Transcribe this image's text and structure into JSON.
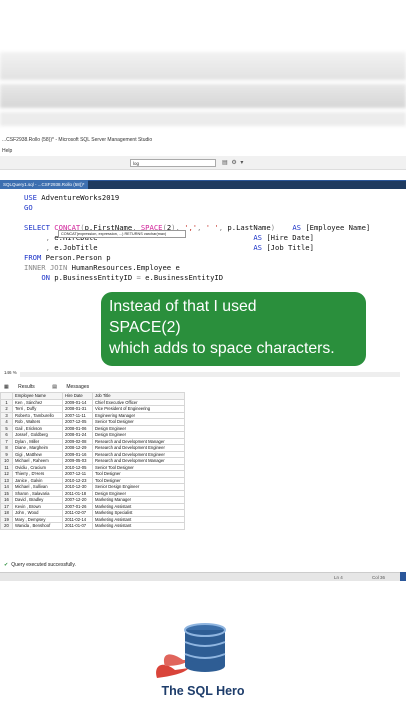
{
  "window": {
    "title": "...CSF2938.Rollo (58))* - Microsoft SQL Server Management Studio",
    "menu_fragment": "Help"
  },
  "toolbar": {
    "search_value": "log",
    "icons": [
      "database-icon",
      "settings-icon",
      "dropdown-icon"
    ]
  },
  "tab": {
    "label": "SQLQuery1.sql - ...CSF2938.Rollo (58))*"
  },
  "editor": {
    "lines": [
      "USE AdventureWorks2019",
      "GO",
      "",
      "SELECT CONCAT(p.FirstName, SPACE(2), ',', ' ', p.LastName)   AS [Employee Name]",
      "     , e.HireDate                                             AS [Hire Date]",
      "     , e.JobTitle                                             AS [Job Title]",
      "FROM Person.Person p",
      "INNER JOIN HumanResources.Employee e",
      "    ON p.BusinessEntityID = e.BusinessEntityID"
    ],
    "tooltip": "CONCAT(expression, expression, ...) RETURNS varchar(max)"
  },
  "callout": {
    "lines": [
      "Instead of that I used",
      "SPACE(2)",
      "which adds to space characters."
    ]
  },
  "zoom": "146 %",
  "results_tabs": {
    "results": "Results",
    "messages": "Messages"
  },
  "results": {
    "columns": [
      "Employee Name",
      "Hire Date",
      "Job Title"
    ],
    "rows": [
      [
        "1",
        "Ken  , Sánchez",
        "2009-01-14",
        "Chief Executive Officer"
      ],
      [
        "2",
        "Terri  , Duffy",
        "2008-01-31",
        "Vice President of Engineering"
      ],
      [
        "3",
        "Roberto  , Tamburello",
        "2007-11-11",
        "Engineering Manager"
      ],
      [
        "4",
        "Rob  , Walters",
        "2007-12-05",
        "Senior Tool Designer"
      ],
      [
        "5",
        "Gail  , Erickson",
        "2008-01-06",
        "Design Engineer"
      ],
      [
        "6",
        "Jossef  , Goldberg",
        "2008-01-24",
        "Design Engineer"
      ],
      [
        "7",
        "Dylan  , Miller",
        "2009-02-08",
        "Research and Development Manager"
      ],
      [
        "8",
        "Diane  , Margheim",
        "2008-12-29",
        "Research and Development Engineer"
      ],
      [
        "9",
        "Gigi  , Matthew",
        "2009-01-16",
        "Research and Development Engineer"
      ],
      [
        "10",
        "Michael  , Raheem",
        "2009-05-03",
        "Research and Development Manager"
      ],
      [
        "11",
        "Ovidiu  , Cracium",
        "2010-12-05",
        "Senior Tool Designer"
      ],
      [
        "12",
        "Thierry  , D'Hers",
        "2007-12-11",
        "Tool Designer"
      ],
      [
        "13",
        "Janice  , Galvin",
        "2010-12-23",
        "Tool Designer"
      ],
      [
        "14",
        "Michael  , Sullivan",
        "2010-12-30",
        "Senior Design Engineer"
      ],
      [
        "15",
        "Sharon  , Salavaria",
        "2011-01-18",
        "Design Engineer"
      ],
      [
        "16",
        "David  , Bradley",
        "2007-12-20",
        "Marketing Manager"
      ],
      [
        "17",
        "Kevin  , Brown",
        "2007-01-26",
        "Marketing Assistant"
      ],
      [
        "18",
        "John  , Wood",
        "2011-02-07",
        "Marketing Specialist"
      ],
      [
        "19",
        "Mary  , Dempsey",
        "2011-02-14",
        "Marketing Assistant"
      ],
      [
        "20",
        "Wanida  , Benshoof",
        "2011-01-07",
        "Marketing Assistant"
      ]
    ]
  },
  "status": {
    "message": "Query executed successfully.",
    "ln": "Ln 4",
    "col": "Col 36"
  },
  "brand": {
    "name": "The SQL Hero",
    "colors": {
      "accent_green": "#2a8f3c",
      "brand_blue": "#1e3d6b",
      "brand_red": "#d9443a"
    }
  }
}
